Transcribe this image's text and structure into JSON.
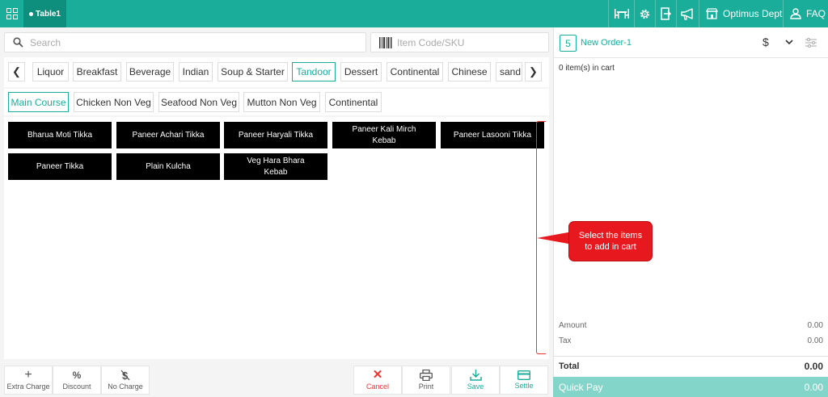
{
  "topbar": {
    "table_label": "Table1",
    "dept_label": "Optimus Dept",
    "faq_label": "FAQ",
    "icons": [
      "grid-icon",
      "table-icon",
      "gear-icon",
      "exit-icon",
      "megaphone-icon",
      "store-icon",
      "user-icon"
    ],
    "color": "#1aad99"
  },
  "search": {
    "placeholder": "Search"
  },
  "sku": {
    "placeholder": "Item Code/SKU"
  },
  "categories": [
    "Liquor",
    "Breakfast",
    "Beverage",
    "Indian",
    "Soup & Starter",
    "Tandoor",
    "Dessert",
    "Continental",
    "Chinese",
    "sand"
  ],
  "active_category": "Tandoor",
  "subcategories": [
    "Main Course",
    "Chicken Non Veg",
    "Seafood Non Veg",
    "Mutton Non Veg",
    "Continental"
  ],
  "active_subcategory": "Main Course",
  "items": [
    "Bharua Moti Tikka",
    "Paneer Achari Tikka",
    "Paneer Haryali Tikka",
    "Paneer Kali Mirch Kebab",
    "Paneer Lasooni Tikka",
    "Paneer Tikka",
    "Plain Kulcha",
    "Veg Hara Bhara Kebab"
  ],
  "bottom_actions": {
    "extra_charge": "Extra Charge",
    "discount": "Discount",
    "no_charge": "No Charge",
    "cancel": "Cancel",
    "print": "Print",
    "save": "Save",
    "settle": "Settle"
  },
  "order": {
    "number": "5",
    "name": "New Order-1",
    "currency_symbol": "$",
    "cart_count": "0 item(s) in cart",
    "amount_label": "Amount",
    "amount_value": "0.00",
    "tax_label": "Tax",
    "tax_value": "0.00",
    "total_label": "Total",
    "total_value": "0.00",
    "quick_pay_label": "Quick Pay",
    "quick_pay_value": "0.00"
  },
  "callout": {
    "text": "Select the items to add in cart",
    "color": "#e8191e"
  }
}
